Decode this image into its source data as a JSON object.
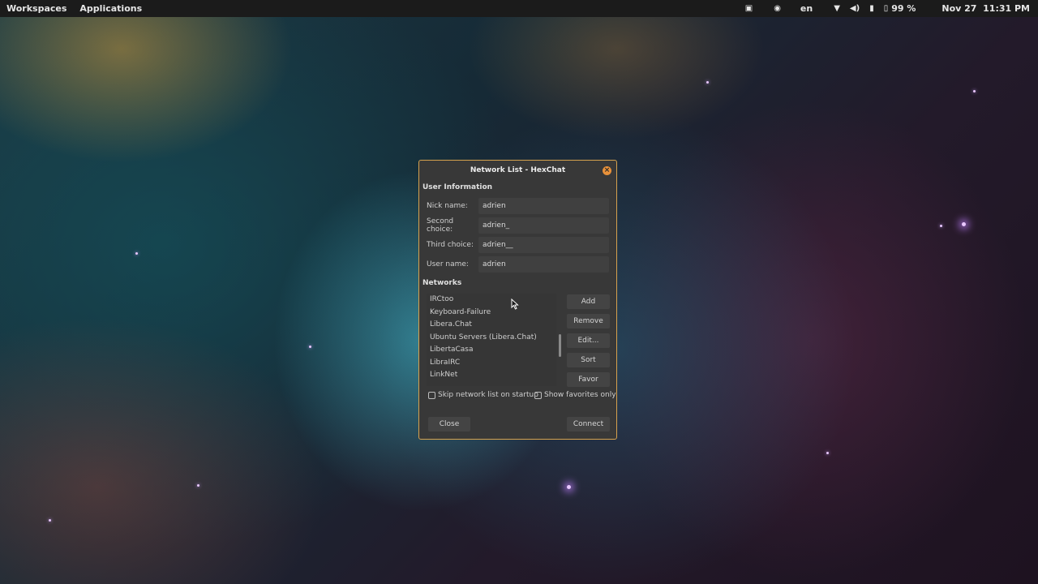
{
  "topbar": {
    "workspaces": "Workspaces",
    "applications": "Applications",
    "keyboard_layout": "en",
    "battery": "99 %",
    "date": "Nov 27",
    "time": "11:31 PM",
    "icons": [
      "screen-icon",
      "network-status-icon",
      "wifi-icon",
      "volume-icon",
      "microphone-icon",
      "battery-icon"
    ]
  },
  "dialog": {
    "title": "Network List - HexChat",
    "user_info_heading": "User Information",
    "fields": [
      {
        "label": "Nick name:",
        "value": "adrien"
      },
      {
        "label": "Second choice:",
        "value": "adrien_"
      },
      {
        "label": "Third choice:",
        "value": "adrien__"
      },
      {
        "label": "User name:",
        "value": "adrien"
      }
    ],
    "networks_heading": "Networks",
    "networks": [
      "IRCtoo",
      "Keyboard-Failure",
      "Libera.Chat",
      "Ubuntu Servers (Libera.Chat)",
      "LibertaCasa",
      "LibraIRC",
      "LinkNet"
    ],
    "side_buttons": [
      "Add",
      "Remove",
      "Edit...",
      "Sort",
      "Favor"
    ],
    "skip_label": "Skip network list on startup",
    "favorites_label": "Show favorites only",
    "close_label": "Close",
    "connect_label": "Connect",
    "accent_color": "#d6a24e"
  }
}
